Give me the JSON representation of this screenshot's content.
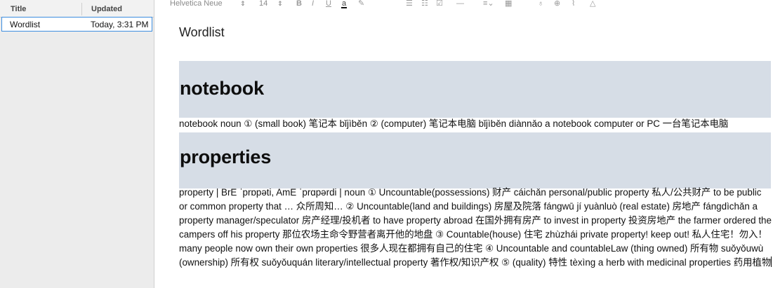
{
  "notes_list": {
    "col_title": "Title",
    "col_updated": "Updated",
    "items": [
      {
        "title": "Wordlist",
        "updated": "Today, 3:31 PM",
        "selected": true
      }
    ]
  },
  "toolbar": {
    "font_name": "Helvetica Neue",
    "font_size": "14",
    "bold": "B",
    "italic": "I",
    "underline": "U",
    "text_color": "a",
    "icons": [
      "stepper-icon",
      "bold-icon",
      "italic-icon",
      "underline-icon",
      "text-color-icon",
      "highlight-icon",
      "bullet-list-icon",
      "numbered-list-icon",
      "checklist-icon",
      "horizontal-rule-icon",
      "align-icon",
      "table-icon",
      "mic-icon",
      "globe-icon",
      "attachment-icon",
      "drive-icon"
    ]
  },
  "document": {
    "title": "Wordlist",
    "entries": [
      {
        "heading": "notebook",
        "definition": "notebook noun ① (small book) 笔记本 bǐjìběn ② (computer) 笔记本电脑 bǐjìběn diànnǎo a notebook computer or PC 一台笔记本电脑"
      },
      {
        "heading": "properties",
        "definition": "property | BrE ˈprɒpəti, AmE ˈprɑpərdi | noun ① Uncountable(possessions) 财产 cáichǎn personal/public property 私人/公共财产 to be public or common property that … 众所周知… ② Uncountable(land and buildings) 房屋及院落 fángwū jí yuànluò (real estate) 房地产 fángdìchǎn a property manager/speculator 房产经理/投机者 to have property abroad 在国外拥有房产 to invest in property 投资房地产 the farmer ordered the campers off his property 那位农场主命令野营者离开他的地盘 ③ Countable(house) 住宅 zhùzhái private property! keep out! 私人住宅！勿入！ many people now own their own properties 很多人现在都拥有自己的住宅 ④ Uncountable and countableLaw (thing owned) 所有物 suǒyǒuwù (ownership) 所有权 suǒyǒuquán literary/intellectual property 著作权/知识产权 ⑤ (quality) 特性 tèxìng a herb with medicinal properties 药用植物"
      }
    ]
  },
  "colors": {
    "heading_band": "#d6dde6",
    "selection_border": "#3d8ee0",
    "sidebar_bg": "#ececec"
  }
}
